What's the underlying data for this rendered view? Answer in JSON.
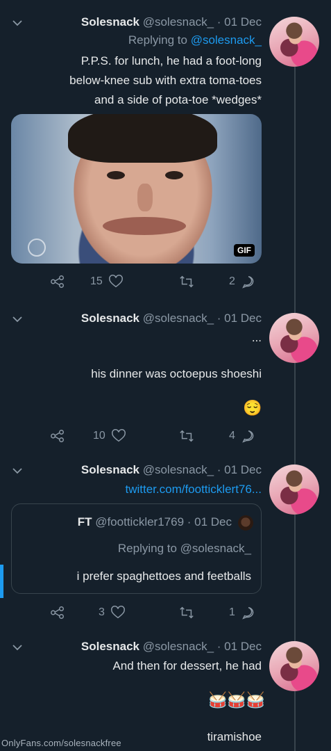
{
  "tweets": [
    {
      "name": "Solesnack",
      "handle_date": "@solesnack_ · 01 Dec",
      "replying_prefix": "Replying to ",
      "replying_to": "@solesnack_",
      "text_lines": [
        "P.P.S. for lunch, he had a foot-long",
        "below-knee sub with extra toma-toes",
        "and a side of pota-toe *wedges*"
      ],
      "media": {
        "type": "gif",
        "label": "GIF"
      },
      "replies": "2",
      "retweets": "",
      "likes": "15"
    },
    {
      "name": "Solesnack",
      "handle_date": "@solesnack_ · 01 Dec",
      "text_lines": [
        "...",
        "his dinner was octoepus shoeshi"
      ],
      "emoji": "😌",
      "replies": "4",
      "retweets": "",
      "likes": "10"
    },
    {
      "name": "Solesnack",
      "handle_date": "@solesnack_ · 01 Dec",
      "link": "twitter.com/footticklert76...",
      "quoted": {
        "name": "FT",
        "handle_date": "@foottickler1769 · 01 Dec",
        "replying": "Replying to @solesnack_",
        "text": "i prefer spaghettoes and feetballs"
      },
      "replies": "1",
      "retweets": "",
      "likes": "3"
    },
    {
      "name": "Solesnack",
      "handle_date": "@solesnack_ · 01 Dec",
      "text_lines": [
        "And then for dessert, he had"
      ],
      "emoji": "🥁🥁🥁",
      "last_line": "tiramishoe"
    }
  ],
  "watermark": "OnlyFans.com/solesnackfree",
  "colors": {
    "background": "#15202b",
    "accent": "#1d9bf0",
    "muted": "#8b98a5",
    "text": "#e7e9ea"
  },
  "icons": [
    "chevron-down-icon",
    "share-icon",
    "heart-icon",
    "retweet-icon",
    "reply-icon"
  ]
}
